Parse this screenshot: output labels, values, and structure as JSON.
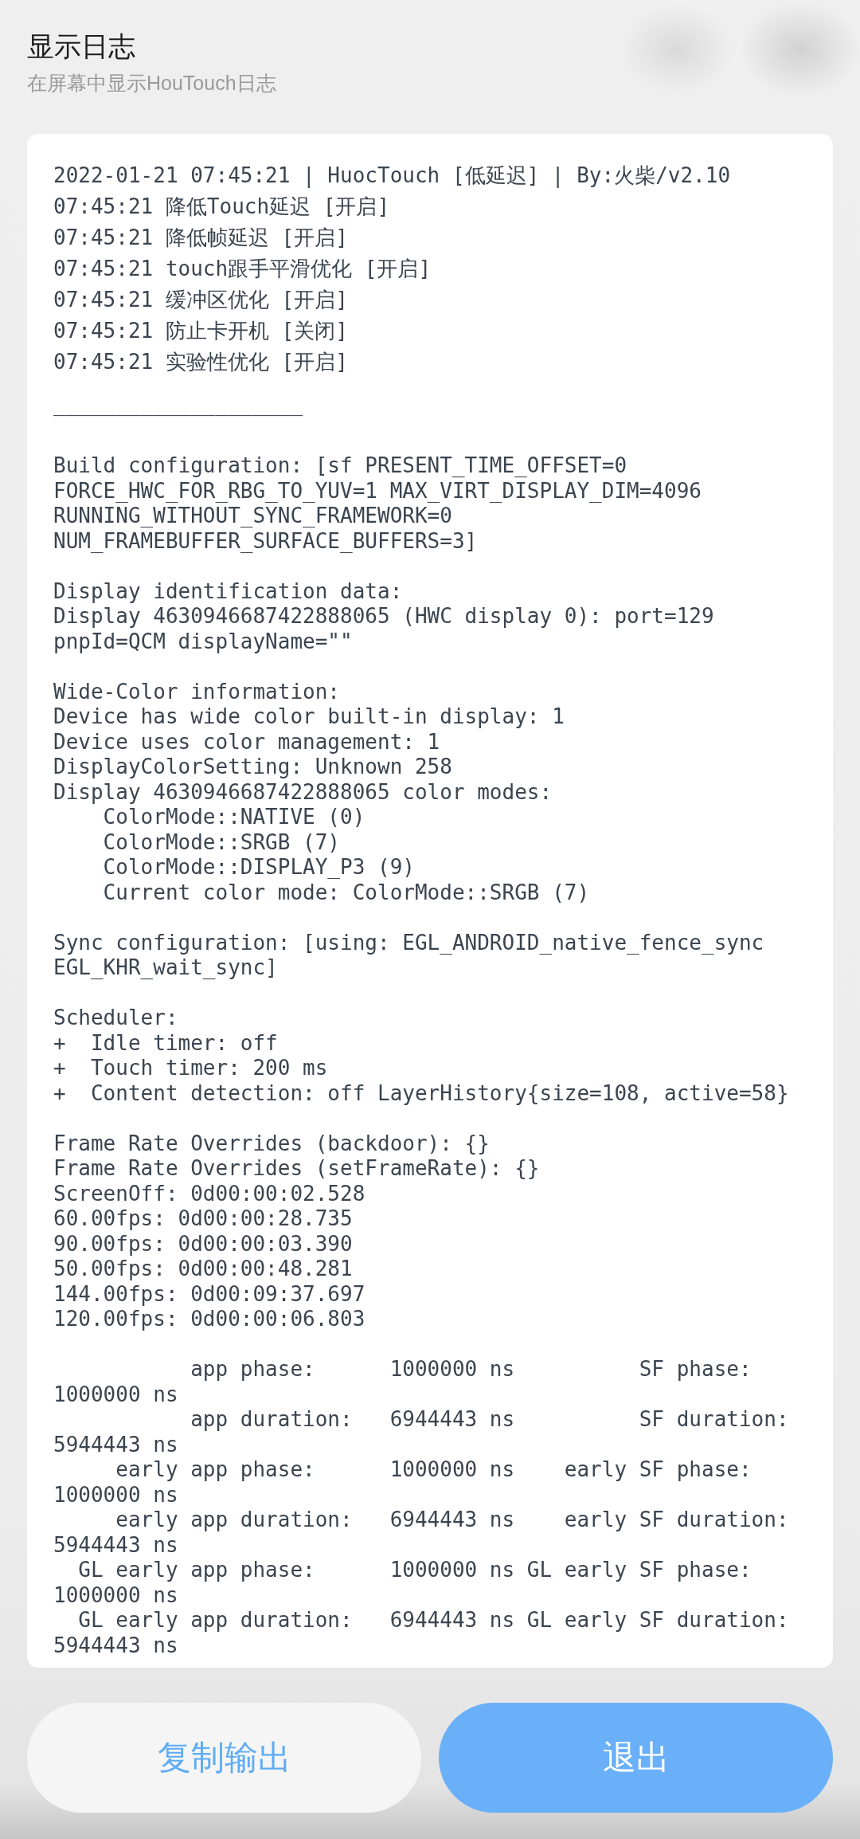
{
  "header": {
    "title": "显示日志",
    "subtitle": "在屏幕中显示HouTouch日志"
  },
  "log": {
    "summary": [
      "2022-01-21 07:45:21 | HuocTouch [低延迟] | By:火柴/v2.10",
      "07:45:21 降低Touch延迟 [开启]",
      "07:45:21 降低帧延迟 [开启]",
      "07:45:21 touch跟手平滑优化 [开启]",
      "07:45:21 缓冲区优化 [开启]",
      "07:45:21 防止卡开机 [关闭]",
      "07:45:21 实验性优化 [开启]"
    ],
    "separator": "____________________",
    "sections": [
      [
        "Build configuration: [sf PRESENT_TIME_OFFSET=0",
        "FORCE_HWC_FOR_RBG_TO_YUV=1 MAX_VIRT_DISPLAY_DIM=4096",
        "RUNNING_WITHOUT_SYNC_FRAMEWORK=0",
        "NUM_FRAMEBUFFER_SURFACE_BUFFERS=3]"
      ],
      [
        "Display identification data:",
        "Display 4630946687422888065 (HWC display 0): port=129",
        "pnpId=QCM displayName=\"\""
      ],
      [
        "Wide-Color information:",
        "Device has wide color built-in display: 1",
        "Device uses color management: 1",
        "DisplayColorSetting: Unknown 258",
        "Display 4630946687422888065 color modes:",
        "    ColorMode::NATIVE (0)",
        "    ColorMode::SRGB (7)",
        "    ColorMode::DISPLAY_P3 (9)",
        "    Current color mode: ColorMode::SRGB (7)"
      ],
      [
        "Sync configuration: [using: EGL_ANDROID_native_fence_sync",
        "EGL_KHR_wait_sync]"
      ],
      [
        "Scheduler:",
        "+  Idle timer: off",
        "+  Touch timer: 200 ms",
        "+  Content detection: off LayerHistory{size=108, active=58}"
      ],
      [
        "Frame Rate Overrides (backdoor): {}",
        "Frame Rate Overrides (setFrameRate): {}",
        "ScreenOff: 0d00:00:02.528",
        "60.00fps: 0d00:00:28.735",
        "90.00fps: 0d00:00:03.390",
        "50.00fps: 0d00:00:48.281",
        "144.00fps: 0d00:09:37.697",
        "120.00fps: 0d00:00:06.803"
      ],
      [
        "           app phase:      1000000 ns          SF phase:",
        "1000000 ns",
        "           app duration:   6944443 ns          SF duration:",
        "5944443 ns",
        "     early app phase:      1000000 ns    early SF phase:",
        "1000000 ns",
        "     early app duration:   6944443 ns    early SF duration:",
        "5944443 ns",
        "  GL early app phase:      1000000 ns GL early SF phase:",
        "1000000 ns",
        "  GL early app duration:   6944443 ns GL early SF duration:",
        "5944443 ns"
      ]
    ]
  },
  "buttons": [
    {
      "label": "复制输出",
      "kind": "secondary"
    },
    {
      "label": "退出",
      "kind": "primary"
    }
  ]
}
